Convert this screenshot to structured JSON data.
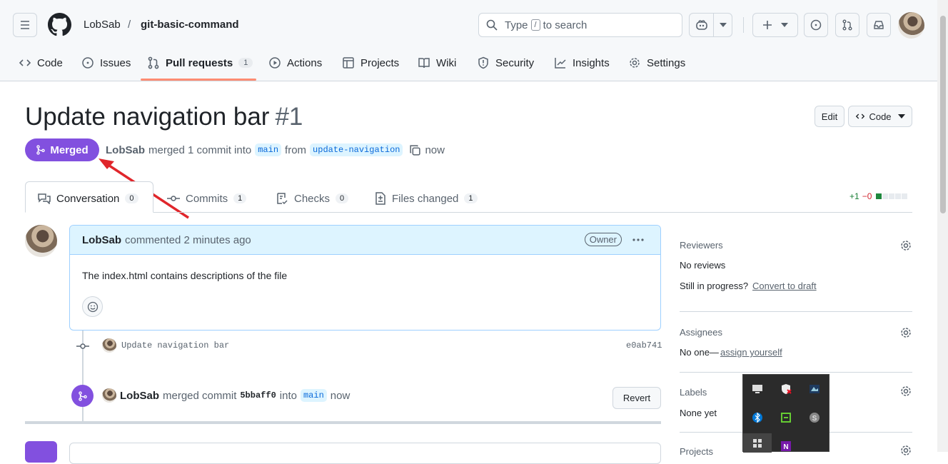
{
  "header": {
    "owner": "LobSab",
    "separator": "/",
    "repo": "git-basic-command",
    "search_prefix": "Type",
    "search_key": "/",
    "search_suffix": "to search"
  },
  "repo_tabs": [
    {
      "label": "Code"
    },
    {
      "label": "Issues"
    },
    {
      "label": "Pull requests",
      "count": "1"
    },
    {
      "label": "Actions"
    },
    {
      "label": "Projects"
    },
    {
      "label": "Wiki"
    },
    {
      "label": "Security"
    },
    {
      "label": "Insights"
    },
    {
      "label": "Settings"
    }
  ],
  "pr": {
    "title": "Update navigation bar",
    "number": "#1",
    "status": "Merged",
    "author": "LobSab",
    "merged_text": "merged 1 commit into",
    "base_branch": "main",
    "from_text": "from",
    "head_branch": "update-navigation",
    "time": "now",
    "edit_label": "Edit",
    "code_label": "Code"
  },
  "pr_tabs": [
    {
      "label": "Conversation",
      "count": "0"
    },
    {
      "label": "Commits",
      "count": "1"
    },
    {
      "label": "Checks",
      "count": "0"
    },
    {
      "label": "Files changed",
      "count": "1"
    }
  ],
  "diffstat": {
    "added": "+1",
    "removed": "−0"
  },
  "comment": {
    "author": "LobSab",
    "action": "commented 2 minutes ago",
    "badge": "Owner",
    "body": "The index.html contains descriptions of the file"
  },
  "commit": {
    "message": "Update navigation bar",
    "sha": "e0ab741"
  },
  "merge_event": {
    "author": "LobSab",
    "text": "merged commit",
    "sha": "5bbaff0",
    "into": "into",
    "branch": "main",
    "time": "now",
    "revert_label": "Revert"
  },
  "sidebar": {
    "reviewers_title": "Reviewers",
    "reviewers_value": "No reviews",
    "in_progress": "Still in progress?",
    "convert_link": "Convert to draft",
    "assignees_title": "Assignees",
    "assignees_value": "No one—",
    "assign_link": "assign yourself",
    "labels_title": "Labels",
    "labels_value": "None yet",
    "projects_title": "Projects"
  },
  "colors": {
    "merged": "#8250df",
    "accent_tab": "#fd8c73",
    "link": "#0969da",
    "annotation_arrow": "#e0262b"
  }
}
